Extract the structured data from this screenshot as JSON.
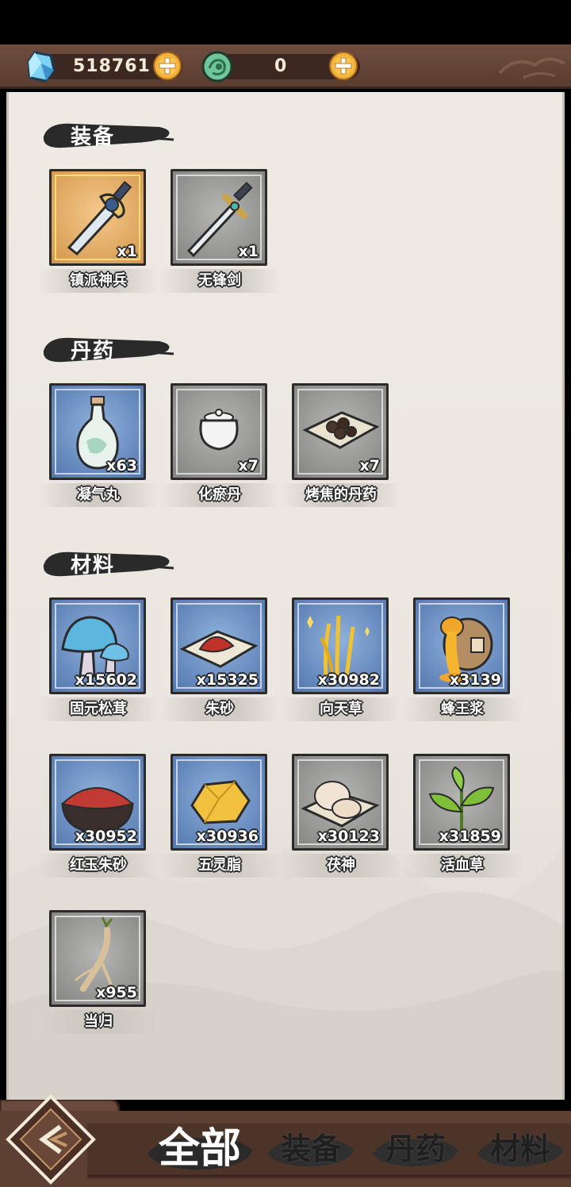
{
  "currency": {
    "spirit_stones": "518761",
    "jade": "0",
    "spirit_stone_icon": "blue-crystal-icon",
    "jade_icon": "green-jade-icon"
  },
  "sections": [
    {
      "title": "装备",
      "items": [
        {
          "name": "镇派神兵",
          "count": "x1",
          "rarity": "gold",
          "icon": "ornate-sword-icon"
        },
        {
          "name": "无锋剑",
          "count": "x1",
          "rarity": "gray",
          "icon": "sword-icon"
        }
      ]
    },
    {
      "title": "丹药",
      "items": [
        {
          "name": "凝气丸",
          "count": "x63",
          "rarity": "blue",
          "icon": "porcelain-bottle-icon"
        },
        {
          "name": "化瘀丹",
          "count": "x7",
          "rarity": "gray",
          "icon": "pill-jar-icon"
        },
        {
          "name": "烤焦的丹药",
          "count": "x7",
          "rarity": "gray",
          "icon": "burnt-pills-icon"
        }
      ]
    },
    {
      "title": "材料",
      "items": [
        {
          "name": "固元松茸",
          "count": "x15602",
          "rarity": "blue",
          "icon": "mushroom-icon"
        },
        {
          "name": "朱砂",
          "count": "x15325",
          "rarity": "blue",
          "icon": "cinnabar-powder-icon"
        },
        {
          "name": "向天草",
          "count": "x30982",
          "rarity": "blue",
          "icon": "golden-grass-icon"
        },
        {
          "name": "蜂王浆",
          "count": "x3139",
          "rarity": "blue",
          "icon": "royal-jelly-jar-icon"
        },
        {
          "name": "红玉朱砂",
          "count": "x30952",
          "rarity": "blue",
          "icon": "red-powder-bowl-icon"
        },
        {
          "name": "五灵脂",
          "count": "x30936",
          "rarity": "blue",
          "icon": "amber-resin-icon"
        },
        {
          "name": "茯神",
          "count": "x30123",
          "rarity": "gray",
          "icon": "fungus-slices-icon"
        },
        {
          "name": "活血草",
          "count": "x31859",
          "rarity": "gray",
          "icon": "herb-leaves-icon"
        },
        {
          "name": "当归",
          "count": "x955",
          "rarity": "gray",
          "icon": "angelica-root-icon"
        }
      ]
    }
  ],
  "tabs": [
    {
      "label": "全部",
      "active": true
    },
    {
      "label": "装备",
      "active": false
    },
    {
      "label": "丹药",
      "active": false
    },
    {
      "label": "材料",
      "active": false
    }
  ],
  "colors": {
    "rarity_gold": "#d9a15a",
    "rarity_blue": "#6a8fc4",
    "rarity_gray": "#9a9b99",
    "bar_brown": "#5f4236",
    "accent_orange": "#f0a433"
  }
}
